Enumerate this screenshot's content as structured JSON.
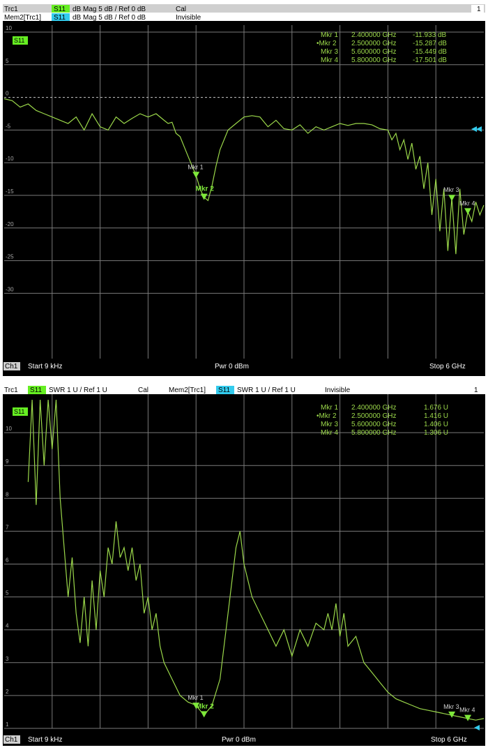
{
  "colors": {
    "trace": "#9bd84a",
    "marker": "#7ee83a",
    "mem_badge": "#33ccee",
    "trace_badge": "#66ee22",
    "grid": "#7a7a7a",
    "header_bg": "#cfcfcf",
    "text": "#ffffff"
  },
  "chart_data": [
    {
      "type": "line",
      "trace_label": "Trc1",
      "trace_badge": "S11",
      "trace_format": "dB Mag  5 dB /  Ref 0 dB",
      "trace_state": "Cal",
      "mem_label": "Mem2[Trc1]",
      "mem_badge": "S11",
      "mem_format": "dB Mag  5 dB /  Ref 0 dB",
      "mem_state": "Invisible",
      "window_number": "1",
      "in_plot_label": "S11",
      "channel": "Ch1",
      "start_label": "Start  9 kHz",
      "power_label": "Pwr  0 dBm",
      "stop_label": "Stop  6 GHz",
      "xlim": [
        0,
        6
      ],
      "ylim": [
        -40,
        10
      ],
      "y_ticks": [
        10,
        5,
        0,
        -5,
        -10,
        -15,
        -20,
        -25,
        -30
      ],
      "y_tick_labels": [
        "10",
        "5",
        "0",
        "-5",
        "-10",
        "-15",
        "-20",
        "-25",
        "-30"
      ],
      "grid": true,
      "ref_level": 0,
      "marker_table": [
        {
          "name": "Mkr 1",
          "freq": "2.400000 GHz",
          "value": "-11.933 dB"
        },
        {
          "name": "•Mkr 2",
          "freq": "2.500000 GHz",
          "value": "-15.287 dB"
        },
        {
          "name": "Mkr 3",
          "freq": "5.600000 GHz",
          "value": "-15.449 dB"
        },
        {
          "name": "Mkr 4",
          "freq": "5.800000 GHz",
          "value": "-17.501 dB"
        }
      ],
      "markers": [
        {
          "label": "Mkr 1",
          "x": 2.4,
          "y": -11.933
        },
        {
          "label": "Mkr 2",
          "x": 2.5,
          "y": -15.287
        },
        {
          "label": "Mkr 3",
          "x": 5.6,
          "y": -15.449
        },
        {
          "label": "Mkr 4",
          "x": 5.8,
          "y": -17.501
        }
      ],
      "series": [
        {
          "x": [
            0,
            0.1,
            0.2,
            0.3,
            0.4,
            0.5,
            0.6,
            0.7,
            0.8,
            0.9,
            1.0,
            1.1,
            1.2,
            1.3,
            1.4,
            1.5,
            1.6,
            1.7,
            1.8,
            1.9,
            2.0,
            2.05,
            2.1,
            2.15,
            2.2,
            2.25,
            2.3,
            2.35,
            2.4,
            2.45,
            2.5,
            2.55,
            2.6,
            2.65,
            2.7,
            2.8,
            2.9,
            3.0,
            3.1,
            3.2,
            3.3,
            3.4,
            3.5,
            3.6,
            3.7,
            3.8,
            3.9,
            4.0,
            4.1,
            4.2,
            4.3,
            4.4,
            4.5,
            4.6,
            4.7,
            4.8,
            4.85,
            4.9,
            4.95,
            5.0,
            5.05,
            5.1,
            5.15,
            5.2,
            5.25,
            5.3,
            5.35,
            5.4,
            5.45,
            5.5,
            5.55,
            5.6,
            5.65,
            5.7,
            5.75,
            5.8,
            5.85,
            5.9,
            5.95,
            6.0
          ],
          "y": [
            -0.2,
            -0.5,
            -1.5,
            -1.0,
            -2.0,
            -2.5,
            -3.0,
            -3.5,
            -4.0,
            -3.0,
            -5.0,
            -2.5,
            -4.5,
            -5.0,
            -3.0,
            -4.0,
            -3.2,
            -2.5,
            -3.0,
            -2.5,
            -3.5,
            -4.0,
            -3.8,
            -5.5,
            -6.0,
            -7.5,
            -9.0,
            -10.5,
            -11.9,
            -14.0,
            -15.3,
            -15.8,
            -13.5,
            -10.5,
            -8.0,
            -5.0,
            -4.0,
            -3.0,
            -2.8,
            -3.0,
            -4.5,
            -3.5,
            -4.8,
            -5.0,
            -4.2,
            -5.5,
            -4.5,
            -5.0,
            -4.5,
            -4.0,
            -4.3,
            -4.0,
            -4.0,
            -4.2,
            -4.8,
            -5.0,
            -6.5,
            -5.5,
            -8.0,
            -6.5,
            -9.5,
            -7.0,
            -11.0,
            -9.0,
            -14.0,
            -10.0,
            -18.0,
            -12.5,
            -20.5,
            -14.0,
            -23.5,
            -15.4,
            -24.0,
            -14.0,
            -21.0,
            -17.5,
            -19.0,
            -16.0,
            -18.0,
            -16.5
          ]
        }
      ]
    },
    {
      "type": "line",
      "trace_label": "Trc1",
      "trace_badge": "S11",
      "trace_format": "SWR  1 U /  Ref 1 U",
      "trace_state": "Cal",
      "mem_label": "Mem2[Trc1]",
      "mem_badge": "S11",
      "mem_format": "SWR  1 U /  Ref 1 U",
      "mem_state": "Invisible",
      "window_number": "1",
      "in_plot_label": "S11",
      "channel": "Ch1",
      "start_label": "Start  9 kHz",
      "power_label": "Pwr  0 dBm",
      "stop_label": "Stop  6 GHz",
      "xlim": [
        0,
        6
      ],
      "ylim": [
        1,
        11
      ],
      "y_ticks": [
        10,
        9,
        8,
        7,
        6,
        5,
        4,
        3,
        2,
        1
      ],
      "y_tick_labels": [
        "10",
        "9",
        "8",
        "7",
        "6",
        "5",
        "4",
        "3",
        "2",
        "1"
      ],
      "grid": true,
      "ref_level": 1,
      "marker_table": [
        {
          "name": "Mkr 1",
          "freq": "2.400000 GHz",
          "value": "1.676 U"
        },
        {
          "name": "•Mkr 2",
          "freq": "2.500000 GHz",
          "value": "1.416 U"
        },
        {
          "name": "Mkr 3",
          "freq": "5.600000 GHz",
          "value": "1.406 U"
        },
        {
          "name": "Mkr 4",
          "freq": "5.800000 GHz",
          "value": "1.306 U"
        }
      ],
      "markers": [
        {
          "label": "Mkr 1",
          "x": 2.4,
          "y": 1.676
        },
        {
          "label": "Mkr 2",
          "x": 2.5,
          "y": 1.416
        },
        {
          "label": "Mkr 3",
          "x": 5.6,
          "y": 1.406
        },
        {
          "label": "Mkr 4",
          "x": 5.8,
          "y": 1.306
        }
      ],
      "series": [
        {
          "x": [
            0.3,
            0.35,
            0.4,
            0.45,
            0.5,
            0.55,
            0.6,
            0.65,
            0.7,
            0.75,
            0.8,
            0.85,
            0.9,
            0.95,
            1.0,
            1.05,
            1.1,
            1.15,
            1.2,
            1.25,
            1.3,
            1.35,
            1.4,
            1.45,
            1.5,
            1.55,
            1.6,
            1.65,
            1.7,
            1.75,
            1.8,
            1.85,
            1.9,
            1.95,
            2.0,
            2.1,
            2.2,
            2.3,
            2.4,
            2.5,
            2.6,
            2.7,
            2.8,
            2.85,
            2.9,
            2.95,
            3.0,
            3.05,
            3.1,
            3.2,
            3.3,
            3.4,
            3.5,
            3.6,
            3.7,
            3.8,
            3.9,
            4.0,
            4.05,
            4.1,
            4.15,
            4.2,
            4.25,
            4.3,
            4.4,
            4.5,
            4.6,
            4.7,
            4.8,
            4.9,
            5.0,
            5.1,
            5.2,
            5.3,
            5.4,
            5.5,
            5.6,
            5.7,
            5.8,
            5.9,
            6.0
          ],
          "y": [
            8.5,
            11.0,
            7.8,
            11.0,
            9.0,
            11.0,
            9.5,
            11.0,
            8.0,
            6.5,
            5.0,
            6.2,
            4.5,
            3.6,
            5.0,
            3.5,
            5.5,
            4.0,
            5.8,
            5.0,
            6.5,
            6.0,
            7.3,
            6.2,
            6.5,
            5.8,
            6.5,
            5.5,
            6.0,
            4.5,
            5.0,
            4.0,
            4.5,
            3.5,
            3.0,
            2.5,
            2.0,
            1.8,
            1.7,
            1.4,
            1.7,
            2.5,
            4.5,
            5.5,
            6.5,
            7.0,
            6.0,
            5.5,
            5.0,
            4.5,
            4.0,
            3.5,
            4.0,
            3.2,
            4.0,
            3.5,
            4.2,
            4.0,
            4.5,
            4.0,
            4.8,
            3.8,
            4.5,
            3.5,
            3.8,
            3.0,
            2.7,
            2.4,
            2.1,
            1.9,
            1.8,
            1.7,
            1.6,
            1.55,
            1.5,
            1.45,
            1.4,
            1.35,
            1.3,
            1.25,
            1.3
          ]
        }
      ]
    }
  ]
}
